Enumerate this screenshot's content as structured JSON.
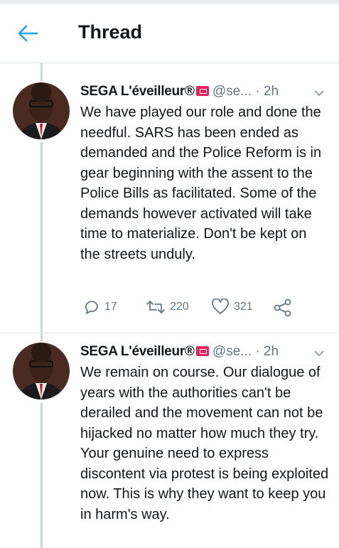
{
  "header": {
    "title": "Thread"
  },
  "tweets": [
    {
      "name": "SEGA L'éveilleur®",
      "handle": "@se...",
      "time": "· 2h",
      "text": "We have played our role and done the needful. SARS has been ended as demanded and the Police Reform is in gear beginning with the assent to the Police Bills as facilitated. Some of the demands however activated will take time to materialize. Don't be kept on the streets unduly.",
      "replies": "17",
      "retweets": "220",
      "likes": "321"
    },
    {
      "name": "SEGA L'éveilleur®",
      "handle": "@se...",
      "time": "· 2h",
      "text": "We remain on course. Our dialogue of years with the authorities can't be derailed and the movement can not be hijacked no matter how much they try. Your genuine need to express discontent via protest is being exploited now. This is why they want to keep you in harm's way."
    }
  ],
  "colors": {
    "accent": "#1da1f2",
    "muted": "#657786",
    "line": "#ccd6dd",
    "badge": "#e0245e"
  }
}
